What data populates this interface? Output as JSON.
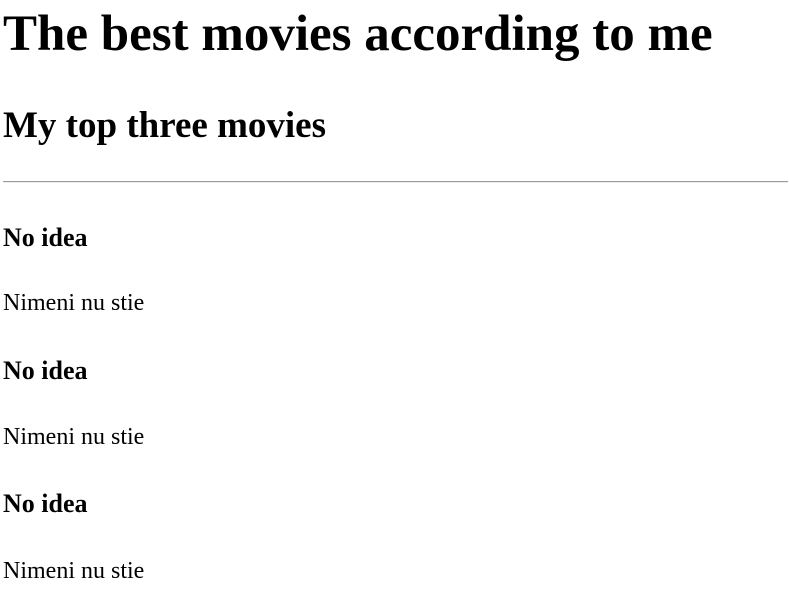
{
  "page": {
    "title": "The best movies according to me",
    "section_title": "My top three movies"
  },
  "movies": [
    {
      "title": "No idea",
      "description": "Nimeni nu stie"
    },
    {
      "title": "No idea",
      "description": "Nimeni nu stie"
    },
    {
      "title": "No idea",
      "description": "Nimeni nu stie"
    }
  ]
}
